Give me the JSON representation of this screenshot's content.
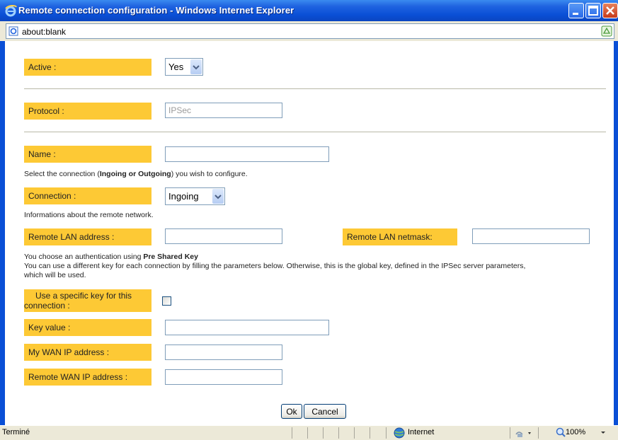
{
  "window": {
    "title": "Remote connection configuration - Windows Internet Explorer",
    "address": "about:blank"
  },
  "form": {
    "active_label": "Active :",
    "active_value": "Yes",
    "protocol_label": "Protocol :",
    "protocol_value": "IPSec",
    "name_label": "Name :",
    "name_value": "",
    "connection_help_prefix": "Select the connection (",
    "connection_help_bold": "Ingoing or Outgoing",
    "connection_help_suffix": ") you wish to configure.",
    "connection_label": "Connection :",
    "connection_value": "Ingoing",
    "remote_info": "Informations about the remote network.",
    "remote_lan_address_label": "Remote LAN address :",
    "remote_lan_address_value": "",
    "remote_lan_netmask_label": "Remote LAN netmask:",
    "remote_lan_netmask_value": "",
    "auth_prefix": "You choose an authentication using ",
    "auth_bold": "Pre Shared Key",
    "auth_line2": "You can use a different key for each connection by filling the parameters below. Otherwise, this is the global key, defined in the IPSec server parameters,",
    "auth_line3": "which will be used.",
    "specific_key_label_line1": "Use a specific key for this",
    "specific_key_label_line2": "connection :",
    "specific_key_checked": false,
    "key_value_label": "Key value :",
    "key_value": "",
    "my_wan_ip_label": "My WAN IP address :",
    "my_wan_ip_value": "",
    "remote_wan_ip_label": "Remote WAN IP address :",
    "remote_wan_ip_value": ""
  },
  "buttons": {
    "ok": "Ok",
    "cancel": "Cancel"
  },
  "status": {
    "text": "Terminé",
    "zone": "Internet",
    "zoom": "100%"
  },
  "colors": {
    "label_bg": "#fdc935",
    "title_bar": "#0a4fd6"
  }
}
